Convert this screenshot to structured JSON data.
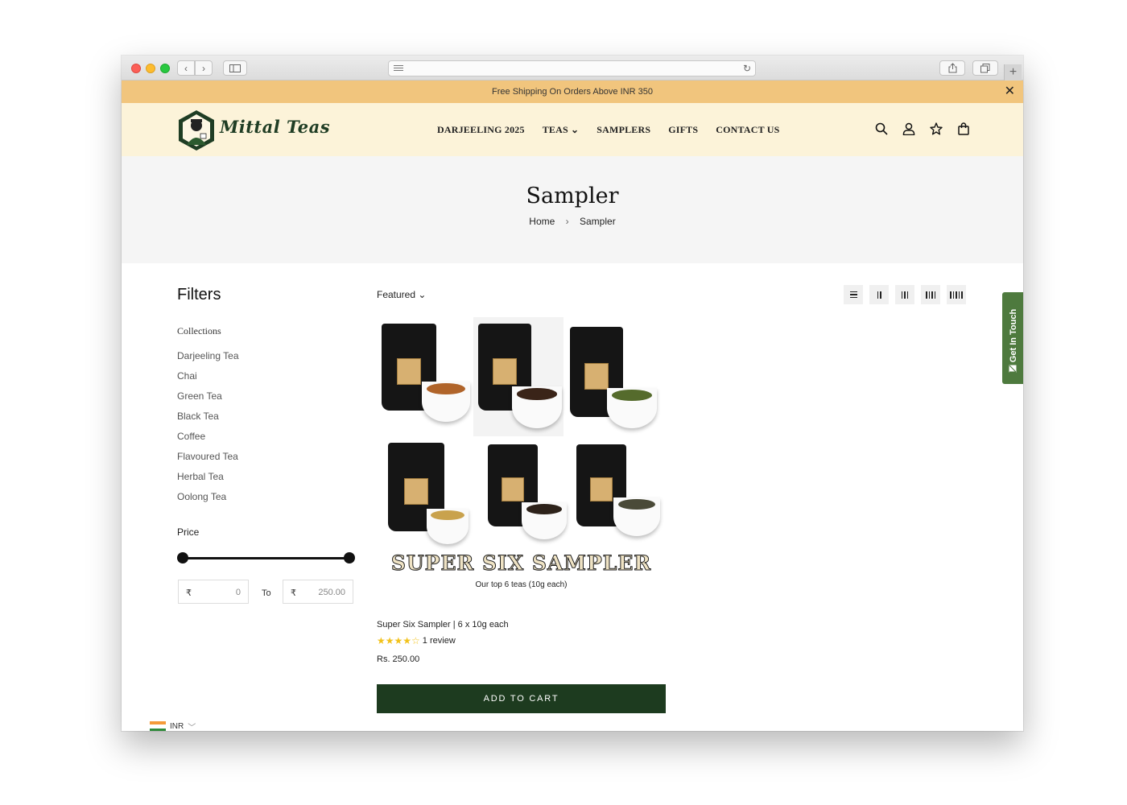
{
  "announcement": {
    "text": "Free Shipping On Orders Above INR 350",
    "close_icon": "close-icon"
  },
  "brand": {
    "name": "Mittal Teas"
  },
  "nav": {
    "items": [
      {
        "label": "DARJEELING 2025"
      },
      {
        "label": "TEAS ⌄"
      },
      {
        "label": "SAMPLERS"
      },
      {
        "label": "GIFTS"
      },
      {
        "label": "CONTACT US"
      }
    ]
  },
  "header_icons": [
    "search-icon",
    "account-icon",
    "wishlist-star-icon",
    "cart-bag-icon"
  ],
  "page": {
    "title": "Sampler",
    "breadcrumb": {
      "home": "Home",
      "separator": "›",
      "current": "Sampler"
    }
  },
  "filters": {
    "title": "Filters",
    "collections_title": "Collections",
    "collections": [
      "Darjeeling Tea",
      "Chai",
      "Green Tea",
      "Black Tea",
      "Coffee",
      "Flavoured Tea",
      "Herbal Tea",
      "Oolong Tea"
    ],
    "price_title": "Price",
    "price_min": {
      "currency": "₹",
      "value": "0"
    },
    "price_to": "To",
    "price_max": {
      "currency": "₹",
      "value": "250.00"
    }
  },
  "toolbar": {
    "sort_label": "Featured ⌄",
    "view_options": [
      "list-view",
      "2-column",
      "3-column",
      "4-column",
      "5-column"
    ]
  },
  "product": {
    "banner_title": "SUPER SIX SAMPLER",
    "banner_subtitle": "Our top 6 teas (10g each)",
    "name": "Super Six Sampler | 6 x 10g each",
    "stars": "★★★★☆",
    "rating_value": 4,
    "rating_text": "1 review",
    "price": "Rs. 250.00",
    "add_to_cart": "ADD TO CART"
  },
  "side_tab": {
    "label": "Get In Touch"
  },
  "currency": {
    "code": "INR",
    "flag": "india-flag"
  },
  "colors": {
    "announcement_bg": "#f1c57d",
    "header_bg": "#fcf3d9",
    "brand_green": "#1d3b1f",
    "side_tab_green": "#4e7a3e",
    "star_yellow": "#f2c21b"
  }
}
